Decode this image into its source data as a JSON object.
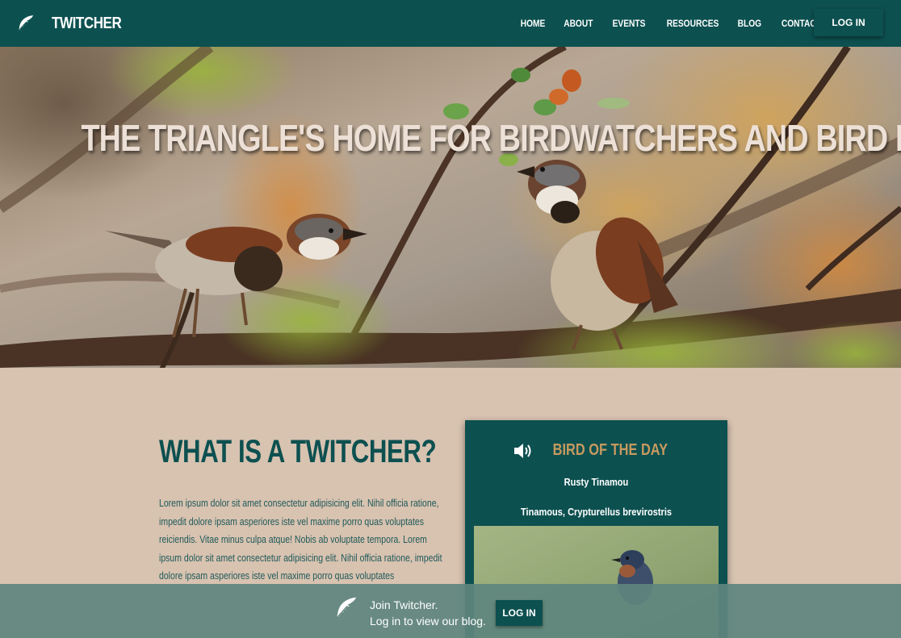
{
  "brand": {
    "name": "TWITCHER",
    "icon": "feather-icon"
  },
  "nav": {
    "links": [
      "HOME",
      "ABOUT",
      "EVENTS",
      "RESOURCES",
      "BLOG",
      "CONTACT US"
    ],
    "login_label": "LOG IN"
  },
  "hero": {
    "title": "THE TRIANGLE'S HOME FOR BIRDWATCHERS AND BIRD LOVERS"
  },
  "about": {
    "title": "WHAT IS A TWITCHER?",
    "text": "Lorem ipsum dolor sit amet consectetur adipisicing elit. Nihil officia ratione, impedit dolore ipsam asperiores iste vel maxime porro quas voluptates reiciendis. Vitae minus culpa atque! Nobis ab voluptate tempora. Lorem ipsum dolor sit amet consectetur adipisicing elit. Nihil officia ratione, impedit dolore ipsam asperiores iste vel maxime porro quas voluptates"
  },
  "bird_of_day": {
    "icon": "speaker-icon",
    "title": "BIRD OF THE DAY",
    "common_name": "Rusty Tinamou",
    "scientific_name": "Tinamous, Crypturellus brevirostris"
  },
  "banner": {
    "icon": "feather-icon",
    "line1": "Join Twitcher.",
    "line2": "Log in to view our blog.",
    "button_label": "LOG IN"
  },
  "colors": {
    "primary": "#0d5050",
    "accent": "#c69a5f",
    "background": "#d8c2b0",
    "banner": "#5f857e"
  }
}
